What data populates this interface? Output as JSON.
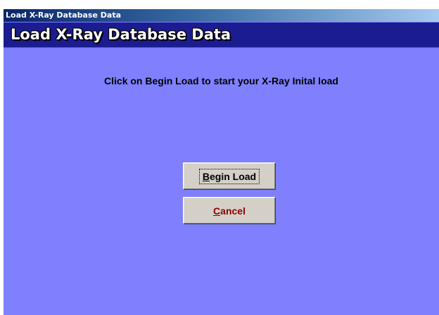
{
  "window": {
    "title": "Load X-Ray Database Data"
  },
  "header": {
    "title": "Load X-Ray Database Data"
  },
  "main": {
    "instruction": "Click on Begin Load to start your X-Ray Inital load"
  },
  "buttons": {
    "begin_load": {
      "mnemonic": "B",
      "rest": "egin Load",
      "label": "Begin Load"
    },
    "cancel": {
      "mnemonic": "C",
      "rest": "ancel",
      "label": "Cancel"
    }
  },
  "colors": {
    "background": "#8080ff",
    "header_band": "#1a1c90",
    "cancel_text": "#8b0000"
  }
}
